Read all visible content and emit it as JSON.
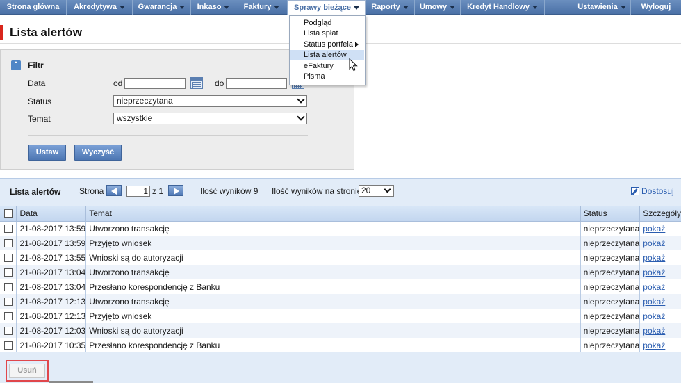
{
  "nav": {
    "items": [
      {
        "label": "Strona główna",
        "has_caret": false
      },
      {
        "label": "Akredytywa",
        "has_caret": true
      },
      {
        "label": "Gwarancja",
        "has_caret": true
      },
      {
        "label": "Inkaso",
        "has_caret": true
      },
      {
        "label": "Faktury",
        "has_caret": true
      },
      {
        "label": "Sprawy bieżące",
        "has_caret": true,
        "active": true
      },
      {
        "label": "Raporty",
        "has_caret": true
      },
      {
        "label": "Umowy",
        "has_caret": true
      },
      {
        "label": "Kredyt Handlowy",
        "has_caret": true
      },
      {
        "label": "Ustawienia",
        "has_caret": true
      },
      {
        "label": "Wyloguj",
        "has_caret": false
      }
    ],
    "dropdown": [
      {
        "label": "Podgląd"
      },
      {
        "label": "Lista spłat"
      },
      {
        "label": "Status portfela",
        "submenu": true
      },
      {
        "label": "Lista alertów",
        "highlighted": true
      },
      {
        "label": "eFaktury"
      },
      {
        "label": "Pisma"
      }
    ]
  },
  "page": {
    "title": "Lista alertów"
  },
  "filter": {
    "title": "Filtr",
    "date_label": "Data",
    "from_label": "od",
    "to_label": "do",
    "date_from": "",
    "date_to": "",
    "status_label": "Status",
    "status_value": "nieprzeczytana",
    "topic_label": "Temat",
    "topic_value": "wszystkie",
    "apply_label": "Ustaw",
    "clear_label": "Wyczyść"
  },
  "results": {
    "title": "Lista alertów",
    "page_label": "Strona",
    "page_value": "1",
    "page_of": "z 1",
    "count_label": "Ilość wyników 9",
    "per_page_label": "Ilość wyników na stronie",
    "per_page_value": "20",
    "customize_label": "Dostosuj",
    "columns": {
      "date": "Data",
      "topic": "Temat",
      "status": "Status",
      "details": "Szczegóły"
    },
    "rows": [
      {
        "date": "21-08-2017 13:59",
        "topic": "Utworzono transakcję",
        "status": "nieprzeczytana",
        "link": "pokaż"
      },
      {
        "date": "21-08-2017 13:59",
        "topic": "Przyjęto wniosek",
        "status": "nieprzeczytana",
        "link": "pokaż"
      },
      {
        "date": "21-08-2017 13:55",
        "topic": "Wnioski są do autoryzacji",
        "status": "nieprzeczytana",
        "link": "pokaż"
      },
      {
        "date": "21-08-2017 13:04",
        "topic": "Utworzono transakcję",
        "status": "nieprzeczytana",
        "link": "pokaż"
      },
      {
        "date": "21-08-2017 13:04",
        "topic": "Przesłano korespondencję z Banku",
        "status": "nieprzeczytana",
        "link": "pokaż"
      },
      {
        "date": "21-08-2017 12:13",
        "topic": "Utworzono transakcję",
        "status": "nieprzeczytana",
        "link": "pokaż"
      },
      {
        "date": "21-08-2017 12:13",
        "topic": "Przyjęto wniosek",
        "status": "nieprzeczytana",
        "link": "pokaż"
      },
      {
        "date": "21-08-2017 12:03",
        "topic": "Wnioski są do autoryzacji",
        "status": "nieprzeczytana",
        "link": "pokaż"
      },
      {
        "date": "21-08-2017 10:35",
        "topic": "Przesłano korespondencję z Banku",
        "status": "nieprzeczytana",
        "link": "pokaż"
      }
    ],
    "delete_label": "Usuń"
  }
}
